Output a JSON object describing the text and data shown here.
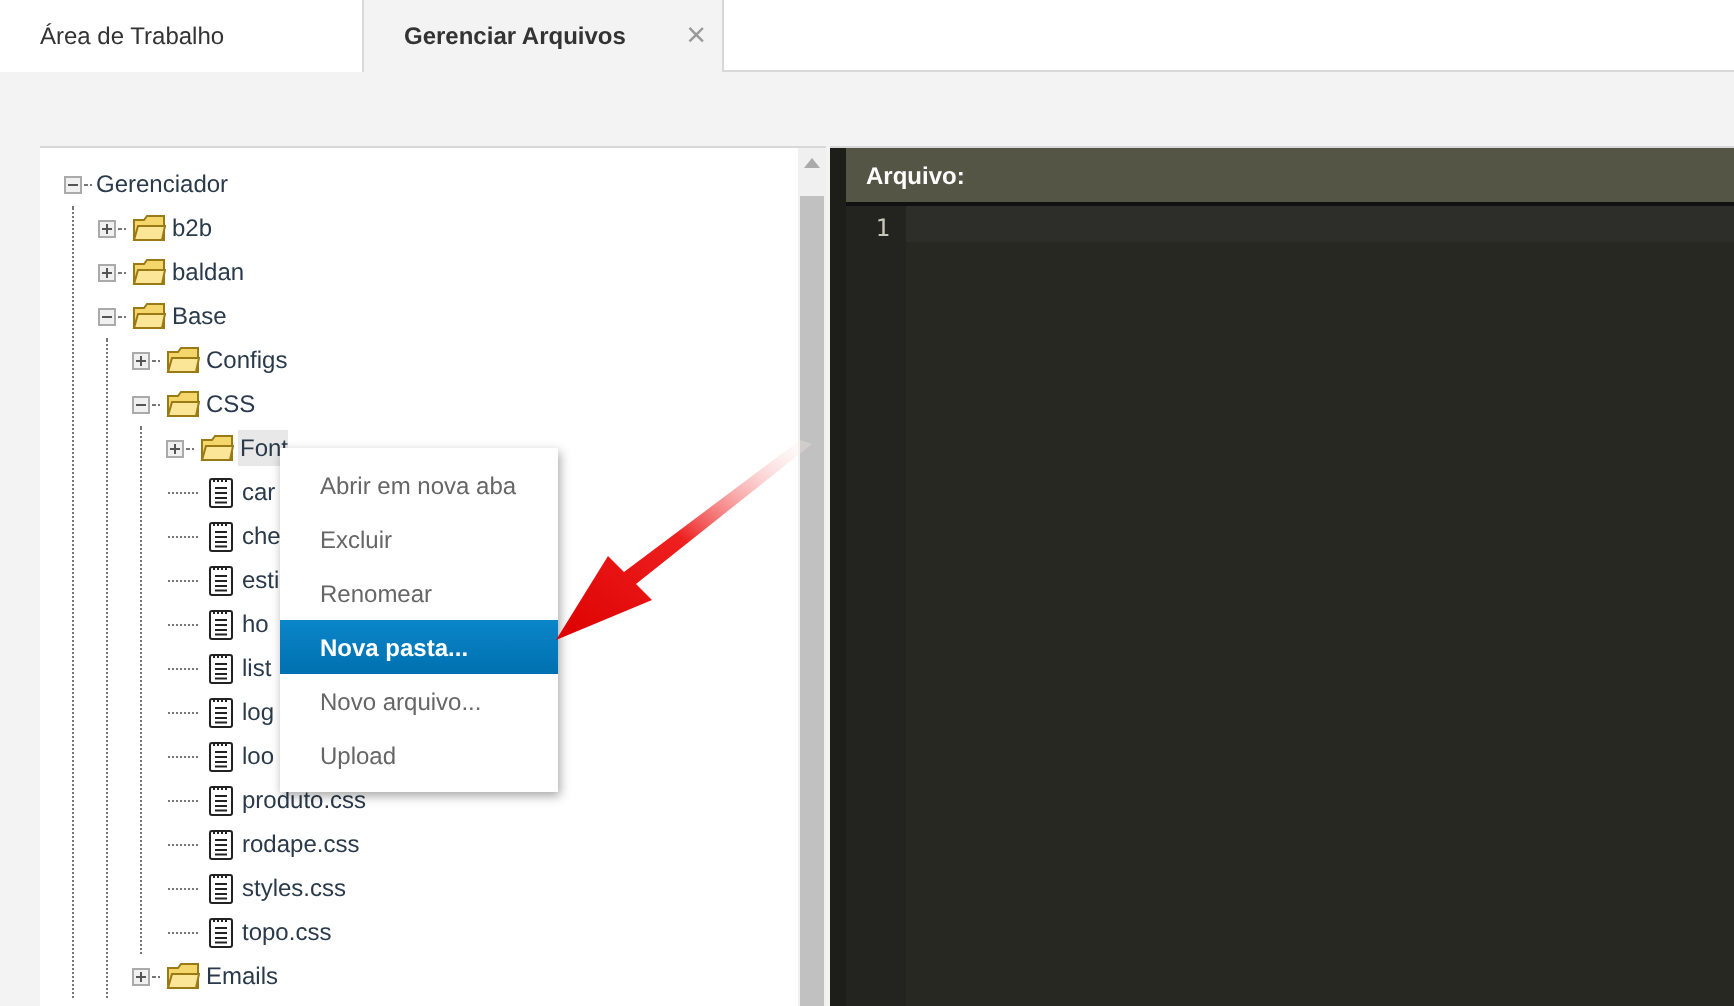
{
  "tabs": [
    {
      "label": "Área de Trabalho",
      "selected": false
    },
    {
      "label": "Gerenciar Arquivos",
      "selected": true,
      "close": "×"
    }
  ],
  "tree": {
    "label": "Gerenciador",
    "expanded": true,
    "selected": false,
    "children": [
      {
        "label": "b2b",
        "kind": "folder",
        "expanded": false,
        "selected": false
      },
      {
        "label": "baldan",
        "kind": "folder",
        "expanded": false,
        "selected": false
      },
      {
        "label": "Base",
        "kind": "folder",
        "expanded": true,
        "selected": false,
        "children": [
          {
            "label": "Configs",
            "kind": "folder",
            "expanded": false,
            "selected": false
          },
          {
            "label": "CSS",
            "kind": "folder",
            "expanded": true,
            "selected": false,
            "children": [
              {
                "label": "Font",
                "kind": "folder",
                "expanded": false,
                "selected": true
              },
              {
                "label": "car",
                "kind": "file",
                "selected": false
              },
              {
                "label": "che",
                "kind": "file",
                "selected": false
              },
              {
                "label": "esti",
                "kind": "file",
                "selected": false
              },
              {
                "label": "ho",
                "kind": "file",
                "selected": false
              },
              {
                "label": "list",
                "kind": "file",
                "selected": false
              },
              {
                "label": "log",
                "kind": "file",
                "selected": false
              },
              {
                "label": "loo",
                "kind": "file",
                "selected": false
              },
              {
                "label": "produto.css",
                "kind": "file",
                "selected": false
              },
              {
                "label": "rodape.css",
                "kind": "file",
                "selected": false
              },
              {
                "label": "styles.css",
                "kind": "file",
                "selected": false
              },
              {
                "label": "topo.css",
                "kind": "file",
                "selected": false
              }
            ]
          },
          {
            "label": "Emails",
            "kind": "folder",
            "expanded": false,
            "selected": false
          }
        ]
      }
    ]
  },
  "context_menu": [
    {
      "label": "Abrir em nova aba",
      "selected": false
    },
    {
      "label": "Excluir",
      "selected": false
    },
    {
      "label": "Renomear",
      "selected": false
    },
    {
      "label": "Nova pasta...",
      "selected": true
    },
    {
      "label": "Novo arquivo...",
      "selected": false
    },
    {
      "label": "Upload",
      "selected": false
    }
  ],
  "editor": {
    "header": "Arquivo:",
    "line_numbers": [
      "1"
    ]
  }
}
